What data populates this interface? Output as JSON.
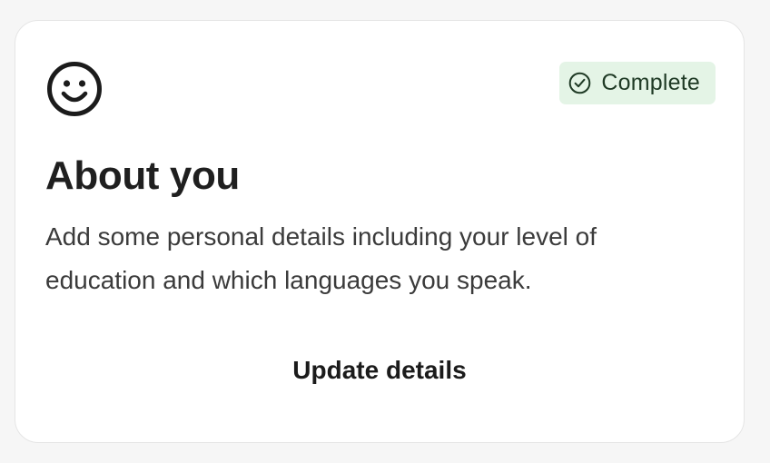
{
  "card": {
    "icon": "smiley-face-icon",
    "status": {
      "label": "Complete",
      "icon": "check-circle-icon",
      "background": "#e4f4e6",
      "color": "#1f3a25"
    },
    "title": "About you",
    "description": "Add some personal details including your level of education and which languages you speak.",
    "action_label": "Update details"
  }
}
